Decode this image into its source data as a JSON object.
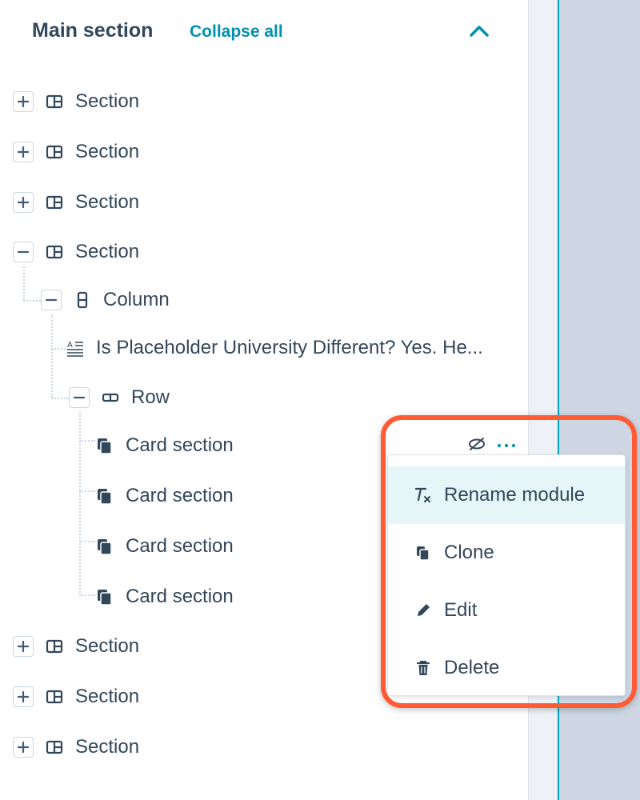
{
  "header": {
    "title": "Main section",
    "collapse_label": "Collapse all"
  },
  "tree": {
    "sections_top": [
      {
        "label": "Section",
        "state": "collapsed"
      },
      {
        "label": "Section",
        "state": "collapsed"
      },
      {
        "label": "Section",
        "state": "collapsed"
      }
    ],
    "expanded_section": {
      "label": "Section",
      "state": "expanded"
    },
    "column": {
      "label": "Column",
      "state": "expanded"
    },
    "rich_text": {
      "label": "Is Placeholder University Different? Yes. He..."
    },
    "row": {
      "label": "Row",
      "state": "expanded"
    },
    "cards": [
      {
        "label": "Card section"
      },
      {
        "label": "Card section"
      },
      {
        "label": "Card section"
      },
      {
        "label": "Card section"
      }
    ],
    "sections_bottom": [
      {
        "label": "Section",
        "state": "collapsed"
      },
      {
        "label": "Section",
        "state": "collapsed"
      },
      {
        "label": "Section",
        "state": "collapsed"
      }
    ]
  },
  "row_actions": {
    "hide_icon": "eye-slash-icon",
    "more_icon": "ellipsis-icon"
  },
  "context_menu": {
    "items": [
      {
        "label": "Rename module",
        "icon": "clear-format-icon",
        "active": true
      },
      {
        "label": "Clone",
        "icon": "clone-icon",
        "active": false
      },
      {
        "label": "Edit",
        "icon": "pencil-icon",
        "active": false
      },
      {
        "label": "Delete",
        "icon": "trash-icon",
        "active": false
      }
    ]
  },
  "colors": {
    "text": "#33475b",
    "link": "#0091ae",
    "accent": "#00a4bd",
    "highlight_border": "#ff5c35",
    "menu_active_bg": "#e5f5f8"
  }
}
